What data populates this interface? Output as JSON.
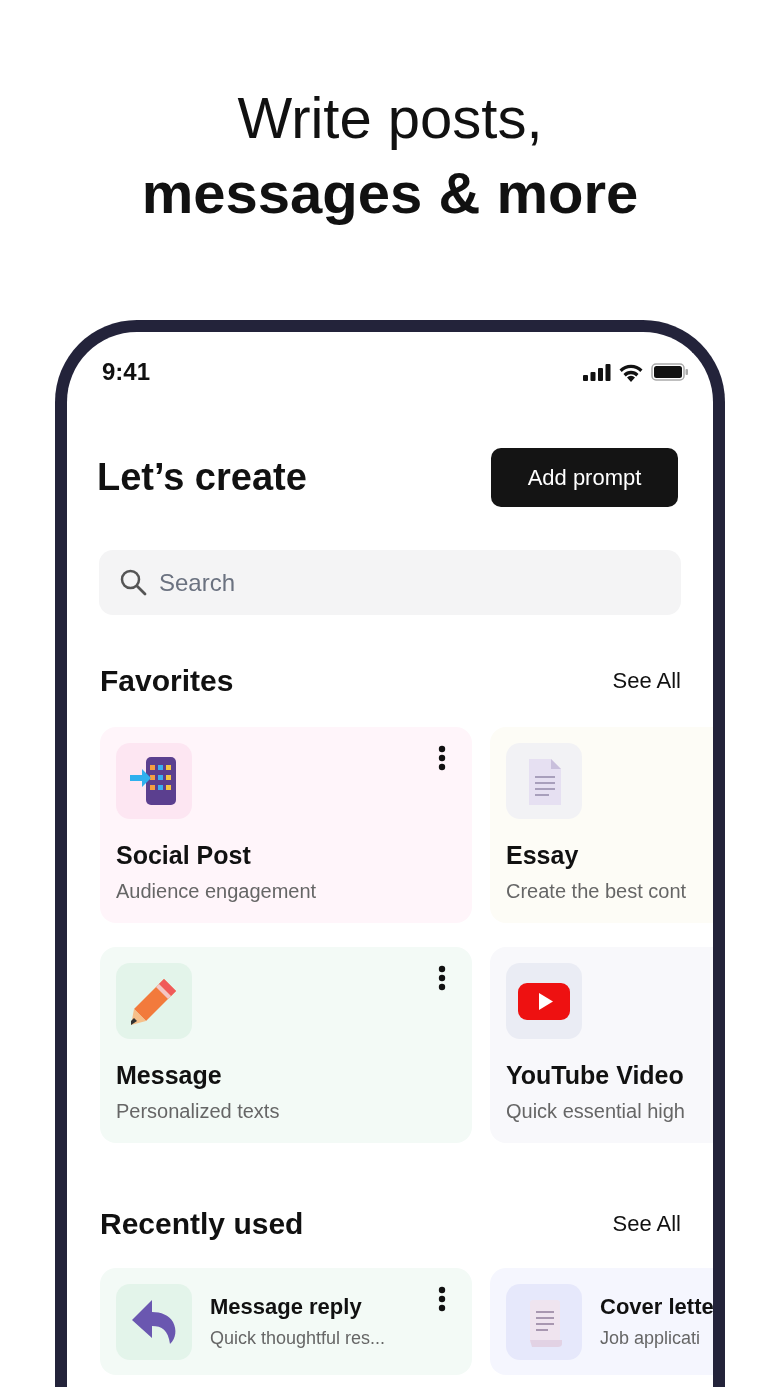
{
  "headline": {
    "line1": "Write posts,",
    "line2": "messages & more"
  },
  "status_bar": {
    "time": "9:41"
  },
  "header": {
    "title": "Let’s create",
    "button": "Add prompt"
  },
  "search": {
    "placeholder": "Search"
  },
  "favorites": {
    "title": "Favorites",
    "see_all": "See All",
    "cards": [
      {
        "kind": "social",
        "title": "Social Post",
        "subtitle": "Audience engagement",
        "menu": true,
        "color": "#fff5fa"
      },
      {
        "kind": "essay",
        "title": "Essay",
        "subtitle": "Create the best cont",
        "menu": false,
        "color": "#fdfcf6"
      },
      {
        "kind": "message",
        "title": "Message",
        "subtitle": "Personalized texts",
        "menu": true,
        "color": "#f3faf6"
      },
      {
        "kind": "video",
        "title": "YouTube Video",
        "subtitle": "Quick essential high",
        "menu": false,
        "color": "#f8f8fb"
      }
    ]
  },
  "recently_used": {
    "title": "Recently used",
    "see_all": "See All",
    "cards": [
      {
        "kind": "reply",
        "title": "Message reply",
        "subtitle": "Quick thoughtful res...",
        "menu": true,
        "color": "#f3faf6"
      },
      {
        "kind": "letter",
        "title": "Cover lette",
        "subtitle": "Job applicati",
        "menu": false,
        "color": "#f5f6fe"
      }
    ]
  }
}
